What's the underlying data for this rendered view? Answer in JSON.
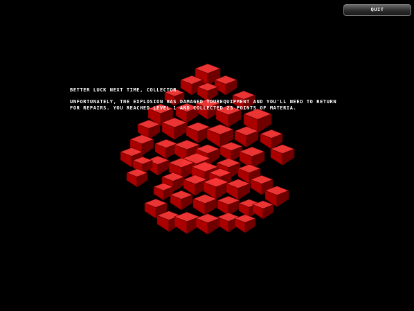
{
  "hud": {
    "quit_label": "QUIT"
  },
  "message": {
    "title": "BETTER LUCK NEXT TIME, COLLECTOR.",
    "body": "UNFORTUNATELY, THE EXPLOSION HAS DAMAGED YOUREQUIPMENT AND YOU'LL NEED TO RETURN FOR REPAIRS. YOU REACHED LEVEL 1 AND COLLECTED 23 POINTS OF MATERIA."
  },
  "scene": {
    "background_color": "#000000",
    "cube_colors": {
      "top": "#ff3a3a",
      "left": "#b80000",
      "right": "#7a0000"
    }
  }
}
